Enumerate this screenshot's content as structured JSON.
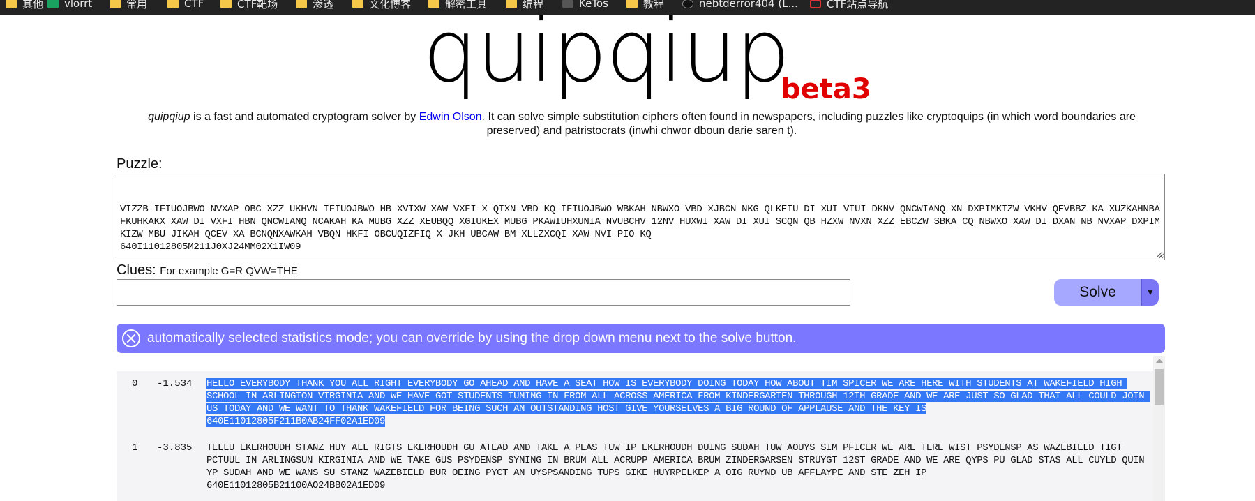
{
  "bookmarks": [
    {
      "label": "其他",
      "icon": "folder-icon"
    },
    {
      "label": "vlorrt",
      "icon": "sheet-icon"
    },
    {
      "label": "常用",
      "icon": "folder-icon"
    },
    {
      "label": "CTF",
      "icon": "folder-icon"
    },
    {
      "label": "CTF靶场",
      "icon": "folder-icon"
    },
    {
      "label": "渗透",
      "icon": "folder-icon"
    },
    {
      "label": "文化博客",
      "icon": "folder-icon"
    },
    {
      "label": "解密工具",
      "icon": "folder-icon"
    },
    {
      "label": "编程",
      "icon": "folder-icon"
    },
    {
      "label": "KeTos",
      "icon": "dot-icon"
    },
    {
      "label": "教程",
      "icon": "folder-icon"
    },
    {
      "label": "nebtderror404 (L...",
      "icon": "github-icon"
    },
    {
      "label": "CTF站点导航",
      "icon": "ctf-icon"
    }
  ],
  "logo": {
    "title": "quipqiup",
    "badge": "beta3"
  },
  "description": {
    "name": "quipqiup",
    "before_link": " is a fast and automated cryptogram solver by ",
    "link": "Edwin Olson",
    "after_link": ". It can solve simple substitution ciphers often found in newspapers, including puzzles like cryptoquips (in which word boundaries are preserved) and patristocrats (inwhi chwor dboun darie saren t)."
  },
  "puzzle": {
    "label": "Puzzle:",
    "value": "VIZZB IFIUOJBWO NVXAP OBC XZZ UKHVN IFIUOJBWO HB XVIXW XAW VXFI X QIXN VBD KQ IFIUOJBWO WBKAH NBWXO VBD XJBCN NKG QLKEIU DI XUI VIUI DKNV QNCWIANQ XN DXPIMKIZW VKHV QEVBBZ KA XUZKAHNBA FKUHKAKX XAW DI VXFI HBN QNCWIANQ NCAKAH KA MUBG XZZ XEUBQQ XGIUKEX MUBG PKAWIUHXUNIA NVUBCHV 12NV HUXWI XAW DI XUI SCQN QB HZXW NVXN XZZ EBCZW SBKA CQ NBWXO XAW DI DXAN NB NVXAP DXPIMKIZW MBU JIKAH QCEV XA BCNQNXAWKAH VBQN HKFI OBCUQIZFIQ X JKH UBCAW BM XLLZXCQI XAW NVI PIO KQ\n640I11012805M211J0XJ24MM02X1IW09"
  },
  "clues": {
    "label": "Clues:",
    "hint": "For example G=R QVW=THE",
    "value": ""
  },
  "solve": {
    "label": "Solve",
    "dropdown": "▼"
  },
  "banner": {
    "text": "automatically selected statistics mode; you can override by using the drop down menu next to the solve button."
  },
  "results": [
    {
      "index": "0",
      "score": "-1.534",
      "text": "HELLO EVERYBODY THANK YOU ALL RIGHT EVERYBODY GO AHEAD AND HAVE A SEAT HOW IS EVERYBODY DOING TODAY HOW ABOUT TIM SPICER WE ARE HERE WITH STUDENTS AT WAKEFIELD HIGH SCHOOL IN ARLINGTON VIRGINIA AND WE HAVE GOT STUDENTS TUNING IN FROM ALL ACROSS AMERICA FROM KINDERGARTEN THROUGH 12TH GRADE AND WE ARE JUST SO GLAD THAT ALL COULD JOIN US TODAY AND WE WANT TO THANK WAKEFIELD FOR BEING SUCH AN OUTSTANDING HOST GIVE YOURSELVES A BIG ROUND OF APPLAUSE AND THE KEY IS\n640E11012805F211B0AB24FF02A1ED09"
    },
    {
      "index": "1",
      "score": "-3.835",
      "text": "TELLU EKERHOUDH STANZ HUY ALL RIGTS EKERHOUDH GU ATEAD AND TAKE A PEAS TUW IP EKERHOUDH DUING SUDAH TUW AOUYS SIM PFICER WE ARE TERE WIST PSYDENSP AS WAZEBIELD TIGT PCTUUL IN ARLINGSUN KIRGINIA AND WE TAKE GUS PSYDENSP SYNING IN BRUM ALL ACRUPP AMERICA BRUM ZINDERGARSEN STRUYGT 12ST GRADE AND WE ARE QYPS PU GLAD STAS ALL CUYLD QUIN YP SUDAH AND WE WANS SU STANZ WAZEBIELD BUR OEING PYCT AN UYSPSANDING TUPS GIKE HUYRPELKEP A OIG RUYND UB AFFLAYPE AND STE ZEH IP\n640E11012805B21100AO24BB02A1ED09"
    }
  ]
}
